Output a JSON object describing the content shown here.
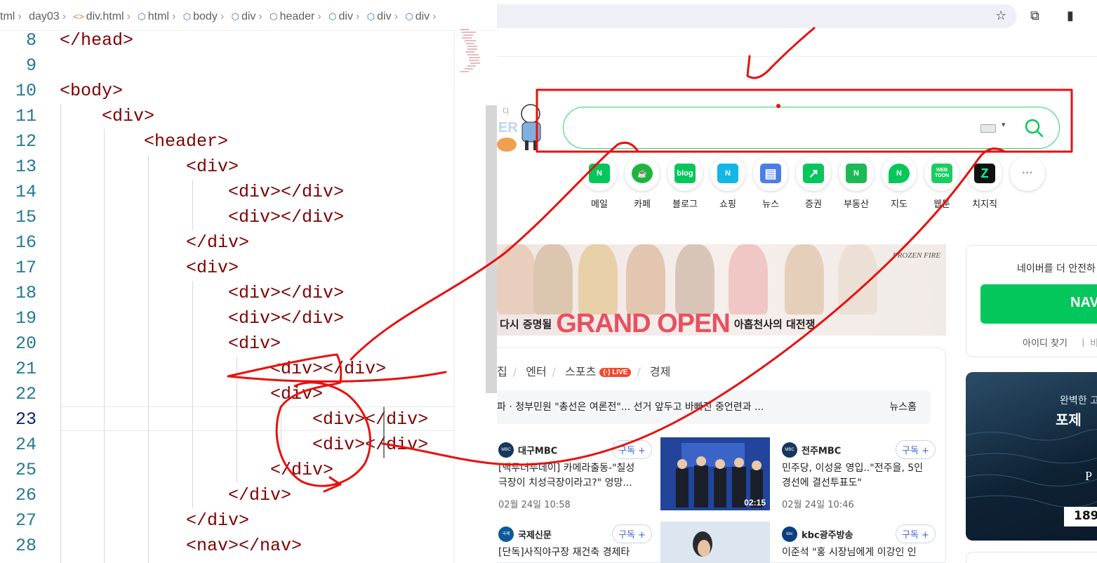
{
  "editor": {
    "breadcrumbs": [
      "tml",
      "day03",
      "div.html",
      "html",
      "body",
      "div",
      "header",
      "div",
      "div",
      "div"
    ],
    "lines": [
      {
        "num": "8",
        "code": "</head>"
      },
      {
        "num": "9",
        "code": ""
      },
      {
        "num": "10",
        "code": "<body>"
      },
      {
        "num": "11",
        "code": "    <div>"
      },
      {
        "num": "12",
        "code": "        <header>"
      },
      {
        "num": "13",
        "code": "            <div>"
      },
      {
        "num": "14",
        "code": "                <div></div>"
      },
      {
        "num": "15",
        "code": "                <div></div>"
      },
      {
        "num": "16",
        "code": "            </div>"
      },
      {
        "num": "17",
        "code": "            <div>"
      },
      {
        "num": "18",
        "code": "                <div></div>"
      },
      {
        "num": "19",
        "code": "                <div></div>"
      },
      {
        "num": "20",
        "code": "                <div>"
      },
      {
        "num": "21",
        "code": "                    <div></div>"
      },
      {
        "num": "22",
        "code": "                    <div>"
      },
      {
        "num": "23",
        "code": "                        <div></div>"
      },
      {
        "num": "24",
        "code": "                        <div></div>"
      },
      {
        "num": "25",
        "code": "                    </div>"
      },
      {
        "num": "26",
        "code": "                </div>"
      },
      {
        "num": "27",
        "code": "            </div>"
      },
      {
        "num": "28",
        "code": "            <nav></nav>"
      }
    ],
    "current_line": 23
  },
  "browser": {
    "toolbar_icons": [
      "star-icon",
      "extensions-icon",
      "side-panel-icon"
    ],
    "toolbar_glyphs": {
      "star": "☆",
      "extensions": "⧉",
      "side_panel": "▮"
    },
    "search": {
      "value": "",
      "keyboard_arrow": "▾"
    },
    "services": [
      {
        "label": "메일",
        "icon": "mail-icon",
        "color": "#03c75a",
        "glyph": "N"
      },
      {
        "label": "카페",
        "icon": "cafe-icon",
        "color": "#1fb53b",
        "glyph": "☕"
      },
      {
        "label": "블로그",
        "icon": "blog-icon",
        "color": "#03c75a",
        "glyph": "blog"
      },
      {
        "label": "쇼핑",
        "icon": "shopping-icon",
        "color": "#14b6e8",
        "glyph": "N"
      },
      {
        "label": "뉴스",
        "icon": "news-icon",
        "color": "#4a7de8",
        "glyph": "▤"
      },
      {
        "label": "증권",
        "icon": "stock-icon",
        "color": "#03c75a",
        "glyph": "↗"
      },
      {
        "label": "부동산",
        "icon": "realestate-icon",
        "color": "#1db954",
        "glyph": "N"
      },
      {
        "label": "지도",
        "icon": "map-icon",
        "color": "#03c75a",
        "glyph": "N"
      },
      {
        "label": "웹툰",
        "icon": "webtoon-icon",
        "color": "#19ce60",
        "glyph": "WEB TOON"
      },
      {
        "label": "치지직",
        "icon": "chzzk-icon",
        "color": "#111111",
        "glyph": "Z"
      },
      {
        "label": "",
        "icon": "more-icon",
        "color": "#ffffff",
        "glyph": "···"
      }
    ],
    "ad": {
      "prefix": "다시 증명될",
      "headline": "GRAND OPEN",
      "suffix": "아홉천사의 대전쟁",
      "brand": "FROZEN FIRE"
    },
    "news": {
      "tabs": [
        "집",
        "엔터",
        "스포츠",
        "경제"
      ],
      "live": "LIVE",
      "ticker": "파 · 청부민원 \"총선은 여론전\"... 선거 앞두고 바빠진 중언련과 ...",
      "ticker_home": "뉴스홈",
      "items": [
        {
          "press": "대구MBC",
          "logo": "MBC NEWS",
          "subscribe": "구독 +",
          "headline1": "[백투더투데이] 카메라출동-\"칠성",
          "headline2": "극장이 치성극장이라고?\" 엉망...",
          "date": "02월 24일 10:58"
        },
        {
          "press": "전주MBC",
          "logo": "MBC NEWS",
          "subscribe": "구독 +",
          "headline1": "민주당, 이성윤 영입..\"전주을, 5인",
          "headline2": "경선에 결선투표도\"",
          "date": "02월 24일 10:46"
        },
        {
          "press": "국제신문",
          "logo": "국제",
          "subscribe": "구독 +",
          "headline1": "[단독]사직야구장 재건축 경제타",
          "headline2": "",
          "date": ""
        },
        {
          "press": "kbc광주방송",
          "logo": "kbc NEWS",
          "subscribe": "구독 +",
          "headline1": "이준석 \"홍 시장님에게 이강인 인",
          "headline2": "",
          "date": ""
        }
      ],
      "video_duration": "02:15"
    },
    "side": {
      "login_message": "네이버를 더 안전하",
      "login_button": "NAV",
      "find_id": "아이디 찾기",
      "find_sep": "ㅣ 비",
      "ad_line1": "완벽한 고",
      "ad_line2": "포제",
      "ad_line3": "P",
      "ad_price": "189"
    }
  },
  "colors": {
    "brand": "#03c75a",
    "annotation": "#ff0000",
    "tag": "#800000",
    "line_number": "#237893"
  }
}
